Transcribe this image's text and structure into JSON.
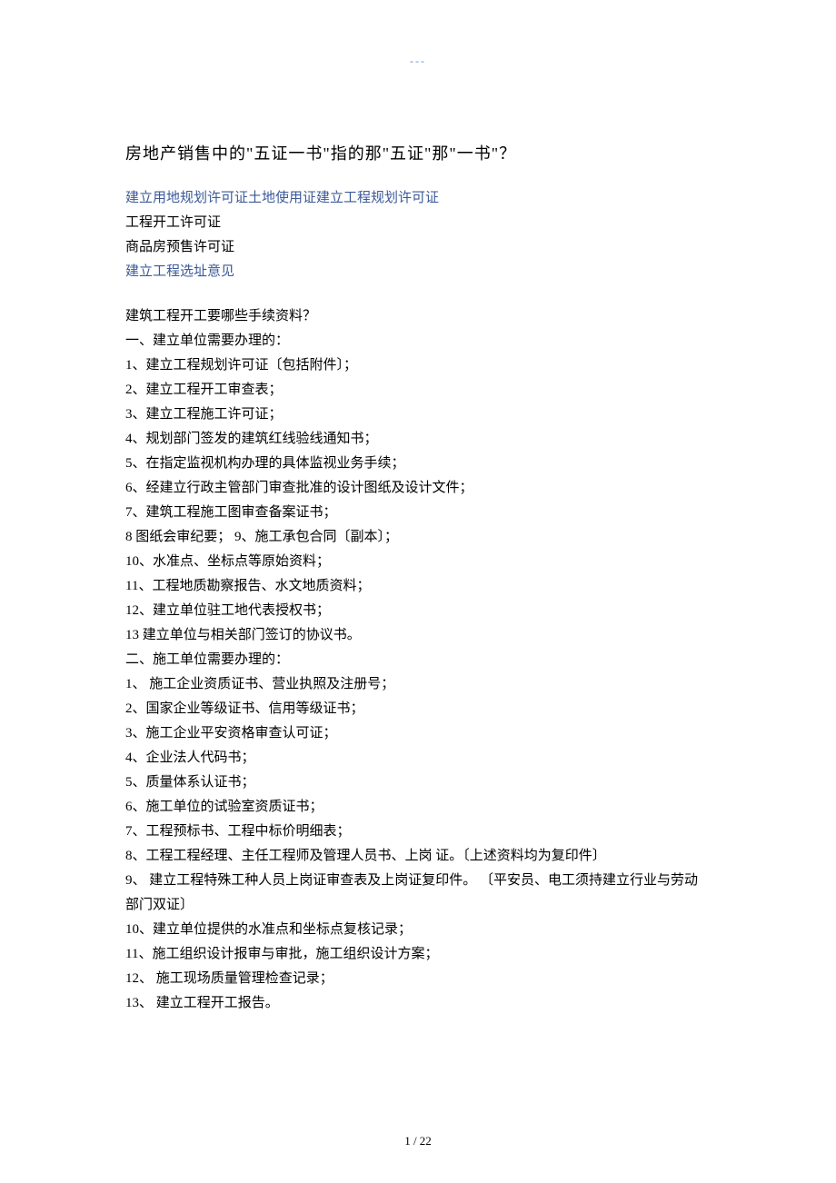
{
  "top_mark": "---",
  "title": "房地产销售中的\"五证一书\"指的那\"五证\"那\"一书\"？",
  "intro_links": {
    "line1": "建立用地规划许可证土地使用证建立工程规划许可证",
    "line4": "建立工程选址意见"
  },
  "intro_text": {
    "line2": "工程开工许可证",
    "line3": "商品房预售许可证"
  },
  "section_a_title": "建筑工程开工要哪些手续资料？",
  "section_a_subtitle": "一、建立单位需要办理的：",
  "section_a_items": [
    "1、建立工程规划许可证〔包括附件〕；",
    "2、建立工程开工审查表；",
    "3、建立工程施工许可证；",
    "4、规划部门签发的建筑红线验线通知书；",
    "5、在指定监视机构办理的具体监视业务手续；",
    "6、经建立行政主管部门审查批准的设计图纸及设计文件；",
    "7、建筑工程施工图审查备案证书；",
    "8 图纸会审纪要；  9、施工承包合同〔副本〕；",
    "10、水准点、坐标点等原始资料；",
    "11、工程地质勘察报告、水文地质资料；",
    "12、建立单位驻工地代表授权书；",
    "13 建立单位与相关部门签订的协议书。"
  ],
  "section_b_subtitle": "二、施工单位需要办理的：",
  "section_b_items": [
    "1、 施工企业资质证书、营业执照及注册号；",
    "2、国家企业等级证书、信用等级证书；",
    "3、施工企业平安资格审查认可证；",
    "4、企业法人代码书；",
    "5、质量体系认证书；",
    "6、施工单位的试验室资质证书；",
    "7、工程预标书、工程中标价明细表；",
    "8、工程工程经理、主任工程师及管理人员书、上岗 证。〔上述资料均为复印件〕",
    "9、 建立工程特殊工种人员上岗证审查表及上岗证复印件。 〔平安员、电工须持建立行业与劳动部门双证〕",
    "10、建立单位提供的水准点和坐标点复核记录；",
    "11、施工组织设计报审与审批，施工组织设计方案；",
    "12、 施工现场质量管理检查记录；",
    "13、 建立工程开工报告。"
  ],
  "page_number": "1 / 22"
}
